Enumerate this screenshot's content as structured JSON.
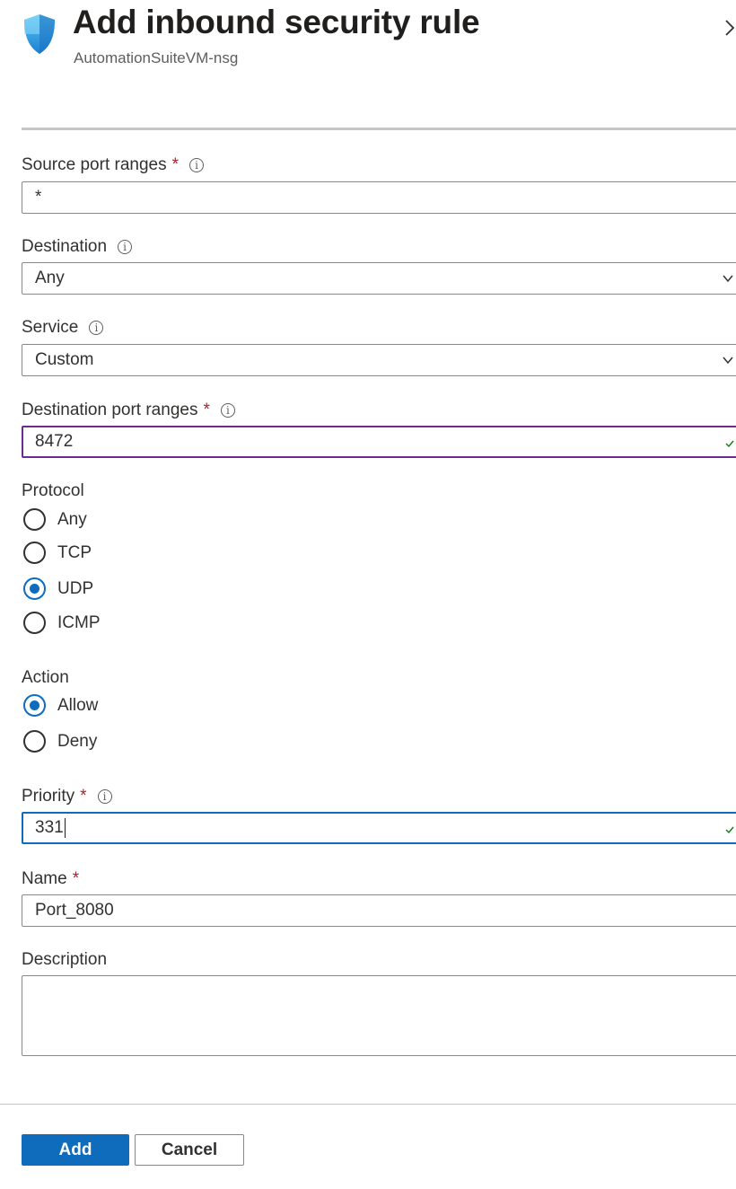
{
  "header": {
    "title": "Add inbound security rule",
    "subtitle": "AutomationSuiteVM-nsg"
  },
  "form": {
    "source_port_ranges": {
      "label": "Source port ranges",
      "required": "*",
      "value": "*"
    },
    "destination": {
      "label": "Destination",
      "value": "Any"
    },
    "service": {
      "label": "Service",
      "value": "Custom"
    },
    "destination_port_ranges": {
      "label": "Destination port ranges",
      "required": "*",
      "value": "8472"
    },
    "protocol": {
      "label": "Protocol",
      "options": [
        "Any",
        "TCP",
        "UDP",
        "ICMP"
      ],
      "selected": "UDP"
    },
    "action": {
      "label": "Action",
      "options": [
        "Allow",
        "Deny"
      ],
      "selected": "Allow"
    },
    "priority": {
      "label": "Priority",
      "required": "*",
      "value": "331"
    },
    "name": {
      "label": "Name",
      "required": "*",
      "value": "Port_8080"
    },
    "description": {
      "label": "Description",
      "value": ""
    }
  },
  "footer": {
    "add_label": "Add",
    "cancel_label": "Cancel"
  },
  "colors": {
    "accent": "#0f6cbd",
    "required": "#a4262c",
    "purple_border": "#6b2c91",
    "success_check": "#107c10"
  },
  "icons": {
    "info": "i"
  }
}
